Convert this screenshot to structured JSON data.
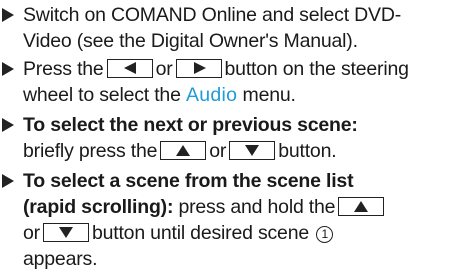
{
  "steps": [
    {
      "lines": [
        "Switch on COMAND Online and select DVD-",
        "Video (see the Digital Owner's Manual)."
      ]
    },
    {
      "line1": {
        "pre": "Press the",
        "mid": "or",
        "post": "button on the steering"
      },
      "line2": {
        "pre": "wheel to select the",
        "display": "Audio",
        "post": "menu."
      },
      "keys": [
        "left-arrow-key",
        "right-arrow-key"
      ]
    },
    {
      "heading": "To select the next or previous scene:",
      "line2": {
        "pre": "briefly press the",
        "mid": "or",
        "post": "button."
      },
      "keys": [
        "up-arrow-key",
        "down-arrow-key"
      ]
    },
    {
      "heading": "To select a scene from the scene list",
      "line2": {
        "bold": "(rapid scrolling):",
        "pre": "press and hold the"
      },
      "line3": {
        "pre": "or",
        "post": "button until desired scene",
        "callout": "1"
      },
      "line4": "appears.",
      "keys": [
        "up-arrow-key",
        "down-arrow-key"
      ]
    }
  ]
}
